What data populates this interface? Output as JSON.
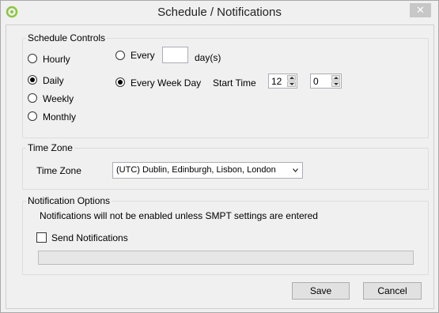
{
  "window": {
    "title": "Schedule / Notifications",
    "close_label": "✕"
  },
  "schedule": {
    "legend": "Schedule Controls",
    "options": [
      {
        "label": "Hourly",
        "checked": false
      },
      {
        "label": "Daily",
        "checked": true
      },
      {
        "label": "Weekly",
        "checked": false
      },
      {
        "label": "Monthly",
        "checked": false
      }
    ],
    "every_label": "Every",
    "every_value": "",
    "days_suffix": "day(s)",
    "every_week_day_label": "Every Week Day",
    "start_time_label": "Start Time",
    "start_hour": "12",
    "start_minute": "0"
  },
  "timezone": {
    "legend": "Time Zone",
    "label": "Time Zone",
    "selected": "(UTC) Dublin, Edinburgh, Lisbon, London"
  },
  "notifications": {
    "legend": "Notification Options",
    "message": "Notifications will not be enabled unless SMPT settings are entered",
    "send_label": "Send Notifications",
    "send_checked": false,
    "progress_value": 0
  },
  "footer": {
    "save_label": "Save",
    "cancel_label": "Cancel"
  }
}
